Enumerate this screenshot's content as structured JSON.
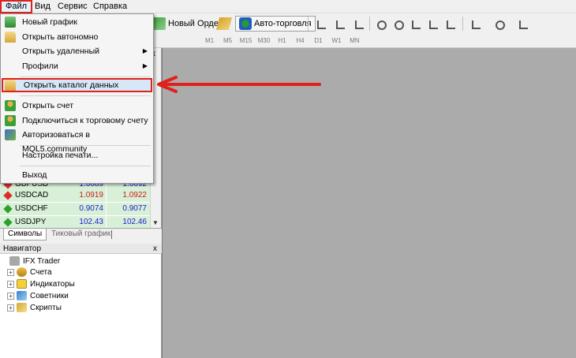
{
  "menubar": {
    "file": "Файл",
    "view": "Вид",
    "service": "Сервис",
    "help": "Справка"
  },
  "toolbar": {
    "new_order": "Новый Ордер",
    "autotrade": "Авто-торговля",
    "timeframes": [
      "M1",
      "M5",
      "M15",
      "M30",
      "H1",
      "H4",
      "D1",
      "W1",
      "MN"
    ]
  },
  "file_menu": {
    "items": [
      {
        "label": "Новый график",
        "icon": "new-chart-icon"
      },
      {
        "label": "Открыть автономно",
        "icon": "folder-icon"
      },
      {
        "label": "Открыть удаленный",
        "icon": "",
        "submenu": true
      },
      {
        "label": "Профили",
        "icon": "",
        "submenu": true
      },
      {
        "label": "Открыть каталог данных",
        "icon": "folder-icon",
        "highlighted": true
      },
      {
        "label": "Открыть счет",
        "icon": "user-icon"
      },
      {
        "label": "Подключиться к торговому счету",
        "icon": "user-icon"
      },
      {
        "label": "Авторизоваться в MQL5.community",
        "icon": "mql5-icon"
      },
      {
        "label": "Настройка печати...",
        "icon": ""
      },
      {
        "label": "Выход",
        "icon": ""
      }
    ],
    "submenu_arrow": "▶"
  },
  "market_watch": {
    "rows": [
      {
        "symbol": "GBPUSD",
        "bid": "1.6689",
        "ask": "1.6692",
        "direction": "down",
        "bid_color": "blue",
        "ask_color": "blue"
      },
      {
        "symbol": "USDCAD",
        "bid": "1.0919",
        "ask": "1.0922",
        "direction": "down",
        "bid_color": "red",
        "ask_color": "red"
      },
      {
        "symbol": "USDCHF",
        "bid": "0.9074",
        "ask": "0.9077",
        "direction": "up",
        "bid_color": "blue",
        "ask_color": "blue"
      },
      {
        "symbol": "USDJPY",
        "bid": "102.43",
        "ask": "102.46",
        "direction": "up",
        "bid_color": "blue",
        "ask_color": "blue"
      }
    ],
    "tabs": [
      "Символы",
      "Тиковый график"
    ],
    "close": "x"
  },
  "navigator": {
    "title": "Навигатор",
    "close": "x",
    "root": "IFX Trader",
    "nodes": [
      "Счета",
      "Индикаторы",
      "Советники",
      "Скрипты"
    ],
    "expander": "+"
  },
  "colors": {
    "highlight_border": "#e0201a",
    "chart_bg": "#ababab",
    "row_bg": "#d8f0d8"
  }
}
